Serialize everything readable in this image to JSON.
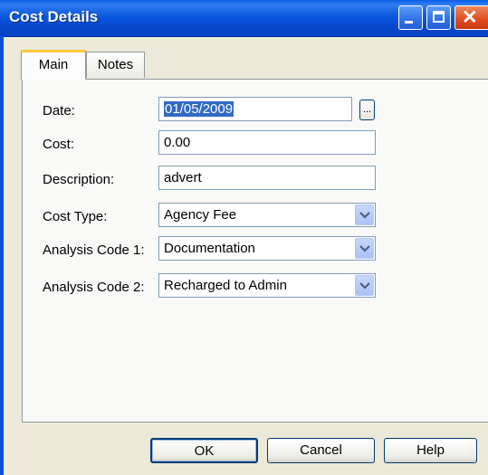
{
  "window": {
    "title": "Cost Details"
  },
  "tabs": [
    {
      "label": "Main",
      "active": true
    },
    {
      "label": "Notes",
      "active": false
    }
  ],
  "form": {
    "date": {
      "label": "Date:",
      "value": "01/05/2009",
      "button_label": "..."
    },
    "cost": {
      "label": "Cost:",
      "value": "0.00"
    },
    "description": {
      "label": "Description:",
      "value": "advert"
    },
    "cost_type": {
      "label": "Cost Type:",
      "value": "Agency Fee"
    },
    "analysis_code_1": {
      "label": "Analysis Code 1:",
      "value": "Documentation"
    },
    "analysis_code_2": {
      "label": "Analysis Code 2:",
      "value": "Recharged to Admin"
    }
  },
  "buttons": {
    "ok": "OK",
    "cancel": "Cancel",
    "help": "Help"
  },
  "colors": {
    "titlebar": "#0a58de",
    "selection": "#316ac5",
    "tab_highlight": "#ffc73c",
    "dialog_bg": "#ece9d8"
  }
}
